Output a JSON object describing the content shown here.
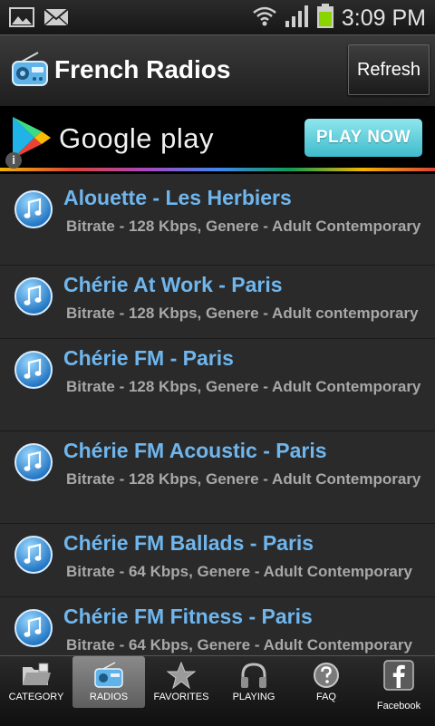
{
  "status_bar": {
    "time": "3:09 PM",
    "icons": [
      "image-notification-icon",
      "mail-icon",
      "wifi-icon",
      "signal-icon",
      "battery-icon"
    ]
  },
  "header": {
    "title": "French Radios",
    "refresh_label": "Refresh",
    "icon": "radio-icon"
  },
  "ad": {
    "brand": "Google play",
    "cta": "PLAY NOW",
    "info_glyph": "i"
  },
  "stations": [
    {
      "title": "Alouette - Les Herbiers",
      "subtitle": "Bitrate - 128 Kbps, Genere - Adult Contemporary"
    },
    {
      "title": "Chérie At Work - Paris",
      "subtitle": "Bitrate - 128 Kbps, Genere - Adult contemporary"
    },
    {
      "title": "Chérie FM - Paris",
      "subtitle": "Bitrate - 128 Kbps, Genere - Adult Contemporary"
    },
    {
      "title": "Chérie FM Acoustic - Paris",
      "subtitle": "Bitrate - 128 Kbps, Genere - Adult Contemporary"
    },
    {
      "title": "Chérie FM Ballads - Paris",
      "subtitle": "Bitrate - 64 Kbps, Genere - Adult Contemporary"
    },
    {
      "title": "Chérie FM Fitness - Paris",
      "subtitle": "Bitrate - 64 Kbps, Genere - Adult Contemporary"
    }
  ],
  "nav": {
    "tabs": [
      {
        "label": "CATEGORY",
        "icon": "folder-icon"
      },
      {
        "label": "RADIOS",
        "icon": "radio-icon",
        "active": true
      },
      {
        "label": "FAVORITES",
        "icon": "star-icon"
      },
      {
        "label": "PLAYING",
        "icon": "headphones-icon"
      },
      {
        "label": "FAQ",
        "icon": "help-icon"
      },
      {
        "label": "Facebook",
        "icon": "facebook-icon"
      }
    ]
  },
  "colors": {
    "station_title": "#6fb6ee",
    "subtitle": "#a8a8a8",
    "cta": "#3fbccb"
  }
}
